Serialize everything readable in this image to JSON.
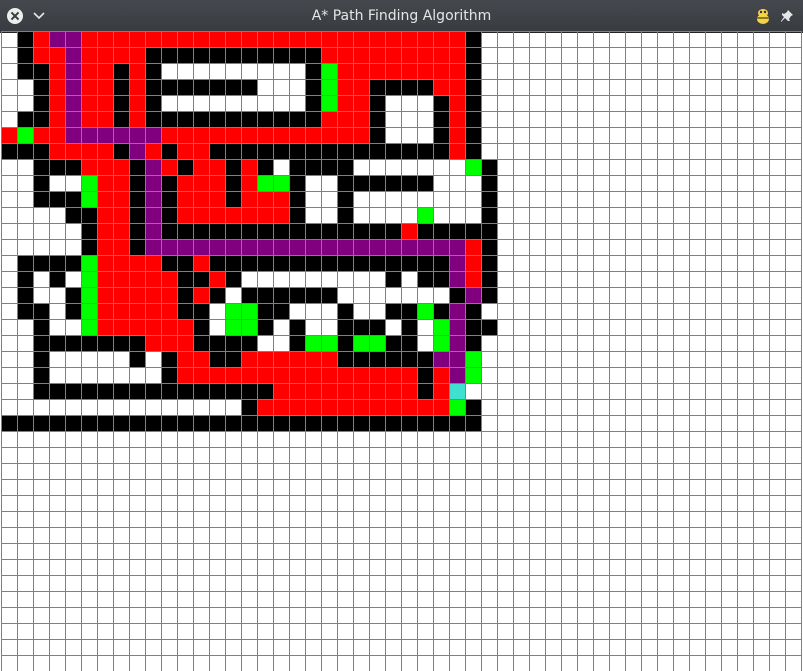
{
  "window": {
    "title": "A* Path Finding Algorithm",
    "icons": [
      "close-icon",
      "chevron-down-icon",
      "python-logo-icon",
      "pin-icon"
    ]
  },
  "grid": {
    "cols": 50,
    "rows": 40,
    "colors": {
      "empty": "#ffffff",
      "barrier": "#000000",
      "closed": "#ff0000",
      "open": "#00ff00",
      "path": "#800080",
      "end": "#40e0d0",
      "line": "#808080"
    },
    "legend": {
      "empty": ".",
      "barrier": "B",
      "closed": "R",
      "open": "G",
      "path": "P",
      "end": "T"
    },
    "cells": [
      ".BRPPRRRRRRRRRRRRRRRRRRRRRRRRB....................",
      ".BRRPRRRRBBBBBBBBBBBRRRRRRRRRB....................",
      ".BBRPRRBRB.........BGRRRRRRRRB....................",
      "..BRPRRBRBBBBBBB...BGRRBBBBRRB....................",
      "..BRPRRBRB.........BGRRB...BRB....................",
      ".BBRPRRBRBBBBBBBBBBBRRRB...BRB....................",
      "RGRRPPPPPPRRRRRRRRRRRRRB...BRB....................",
      "BBBRRRRBPRBRRBBBBBBBBBBBBBBBRB....................",
      "..BBBRRRBPRBRRBRB.BBBB.......GB...................",
      "..B..GRRBPBRRRBRGGB..BBBBBB...B...................",
      "..BBBGRRBPBRRRBRRRB..B........B...................",
      "....BBRRBPBRRRRRRRB..B....G...B...................",
      ".....BRRBPBBBBBBBBBBBBBBBRBBBBB...................",
      ".....BRRBPPPPPPPPPPPPPPPPPPPPRB...................",
      ".BBBBGRRRRBBRBBBBBBBBBBBBBBBPRB...................",
      ".B.B.GRRRRRBBRB.........B.BBPRB...................",
      ".B..BGRRRRRBRB.BBBBBB.......BPB...................",
      ".BB.BGRRRRRBB.GGBB...B..BBGBPB....................",
      "..B..GRRRRRRB.GGB.B..BBB.B.GPBB...................",
      "..BBBBBBBRRRBBBB..BGGBGGBB.GPB....................",
      "..B.....B.BRRBBRRRRRRBBBBBBPPG....................",
      "..B.......BRRRRRRRRRRRRRRRBRPG....................",
      "..BBBBBBBBBBBBBBBRRRRRRRRRBRT.....................",
      "...............BRRRRRRRRRRRRGB....................",
      "BBBBBBBBBBBBBBBBBBBBBBBBBBBBBB...................."
    ]
  }
}
